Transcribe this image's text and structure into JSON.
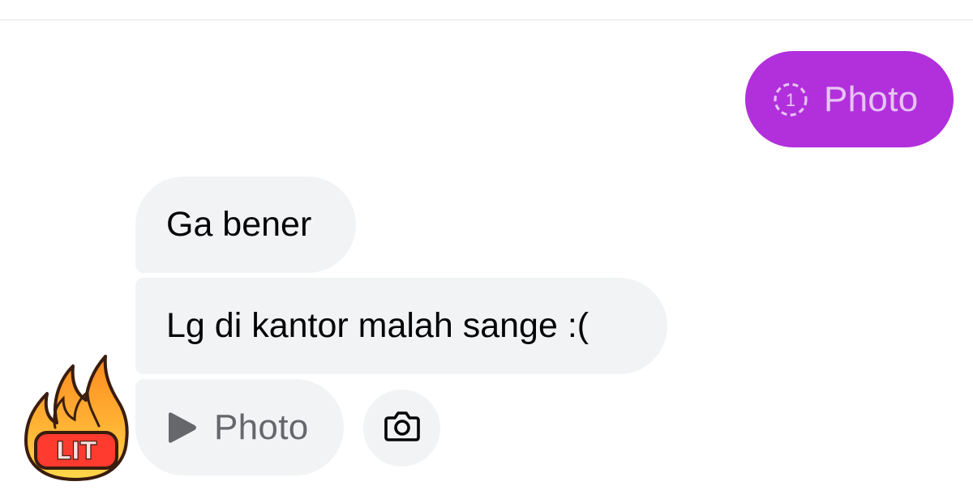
{
  "sent_messages": [
    {
      "type": "photo",
      "label": "Photo",
      "badge": "1"
    }
  ],
  "received_messages": [
    {
      "type": "text",
      "text": "Ga bener"
    },
    {
      "type": "text",
      "text": "Lg di kantor malah sange :("
    },
    {
      "type": "photo",
      "label": "Photo"
    }
  ],
  "avatar": {
    "sticker_text": "LIT",
    "icon": "fire-icon"
  },
  "actions": {
    "camera": "camera-icon"
  },
  "colors": {
    "sent_bubble": "#b230dc",
    "sent_text": "#e7c4f3",
    "received_bubble": "#f1f3f5",
    "received_text": "#050505",
    "muted_text": "#65676b",
    "divider": "#e4e6eb"
  }
}
